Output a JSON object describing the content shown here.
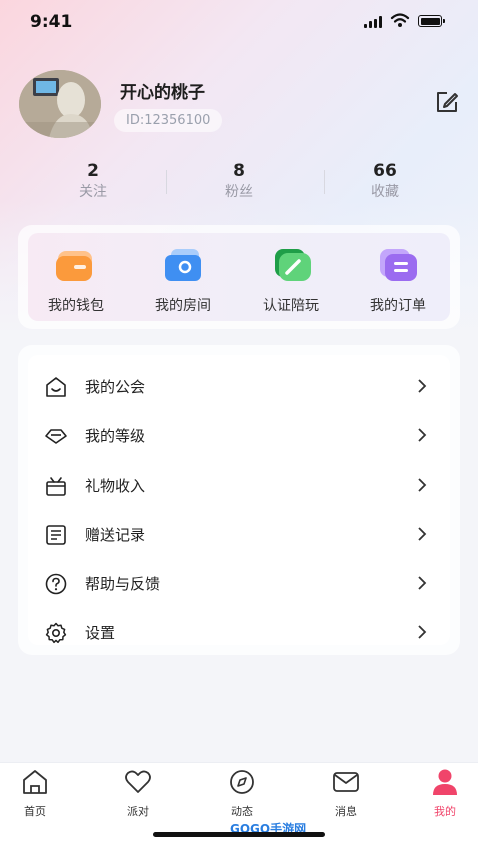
{
  "status_bar": {
    "time": "9:41"
  },
  "profile": {
    "name": "开心的桃子",
    "id_text": "ID:12356100"
  },
  "stats": [
    {
      "value": "2",
      "label": "关注"
    },
    {
      "value": "8",
      "label": "粉丝"
    },
    {
      "value": "66",
      "label": "收藏"
    }
  ],
  "quick_actions": [
    {
      "label": "我的钱包",
      "icon": "wallet-icon",
      "color": "#fb9a3c"
    },
    {
      "label": "我的房间",
      "icon": "room-icon",
      "color": "#3f8ff2"
    },
    {
      "label": "认证陪玩",
      "icon": "certify-icon",
      "color": "#3dbb5a"
    },
    {
      "label": "我的订单",
      "icon": "order-icon",
      "color": "#9b6cf0"
    }
  ],
  "menu": [
    {
      "label": "我的公会",
      "icon": "guild-icon"
    },
    {
      "label": "我的等级",
      "icon": "level-icon"
    },
    {
      "label": "礼物收入",
      "icon": "gift-icon"
    },
    {
      "label": "赠送记录",
      "icon": "record-icon"
    },
    {
      "label": "帮助与反馈",
      "icon": "help-icon"
    },
    {
      "label": "设置",
      "icon": "settings-icon"
    }
  ],
  "tabs": [
    {
      "label": "首页",
      "icon": "home-icon"
    },
    {
      "label": "派对",
      "icon": "heart-icon"
    },
    {
      "label": "动态",
      "icon": "compass-icon"
    },
    {
      "label": "消息",
      "icon": "mail-icon"
    },
    {
      "label": "我的",
      "icon": "profile-icon"
    }
  ],
  "watermark": "GOGO手游网",
  "colors": {
    "accent": "#f0446a"
  }
}
